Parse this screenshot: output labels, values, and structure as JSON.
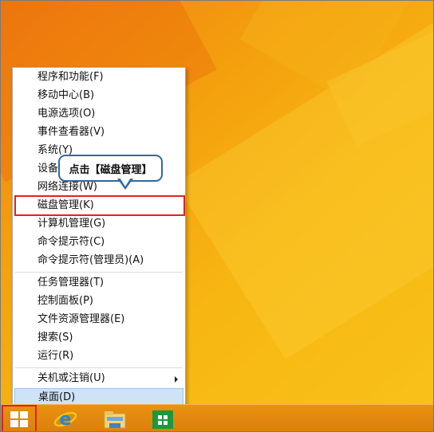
{
  "menu": {
    "items": [
      {
        "label": "程序和功能(F)"
      },
      {
        "label": "移动中心(B)"
      },
      {
        "label": "电源选项(O)"
      },
      {
        "label": "事件查看器(V)"
      },
      {
        "label": "系统(Y)"
      },
      {
        "label": "设备管理器(M)"
      },
      {
        "label": "网络连接(W)"
      },
      {
        "label": "磁盘管理(K)"
      },
      {
        "label": "计算机管理(G)"
      },
      {
        "label": "命令提示符(C)"
      },
      {
        "label": "命令提示符(管理员)(A)"
      },
      {
        "label": "任务管理器(T)"
      },
      {
        "label": "控制面板(P)"
      },
      {
        "label": "文件资源管理器(E)"
      },
      {
        "label": "搜索(S)"
      },
      {
        "label": "运行(R)"
      },
      {
        "label": "关机或注销(U)"
      },
      {
        "label": "桌面(D)"
      }
    ]
  },
  "callout": {
    "text": "点击【磁盘管理】"
  },
  "taskbar": {
    "icons": [
      "windows-start-icon",
      "internet-explorer-icon",
      "file-explorer-icon",
      "windows-store-icon"
    ]
  },
  "colors": {
    "highlight_border": "#e0231b",
    "callout_border": "#2e6aa1",
    "selected_item_bg": "#cfe3f6"
  }
}
